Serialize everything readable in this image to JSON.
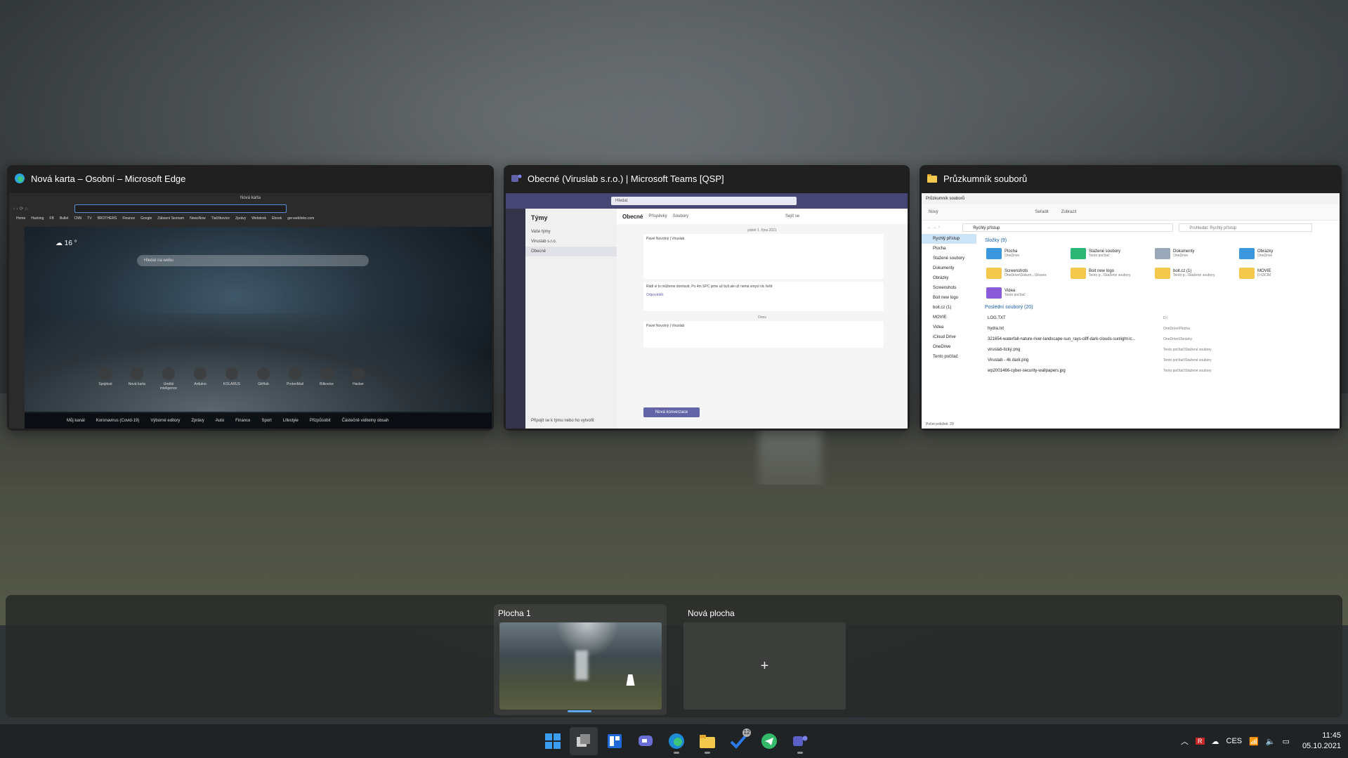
{
  "windows": {
    "edge": {
      "title": "Nová karta – Osobní – Microsoft Edge",
      "tab_title": "Nová karta",
      "favorites": [
        "Home",
        "Hacking",
        "FB",
        "Bullet",
        "CNN",
        "TV",
        "BROTHERS",
        "Finance",
        "Google",
        "Zábavní Seznam",
        "NewsNow",
        "Tlačítkovice",
        "Zprávy",
        "Webdesk",
        "Ebook",
        "gw-weblinks.com"
      ],
      "weather": "16 °",
      "search_placeholder": "Hledat na webu",
      "tiles": [
        "Spojitost",
        "Nová karta",
        "Umělá inteligence",
        "Arduino",
        "KOLARUS",
        "GitHub",
        "ProtonMail",
        "Bilkovice",
        "Hacker"
      ],
      "feed_tabs": [
        "Můj kanál",
        "Koronavirus (Covid-19)",
        "Výborné editory",
        "Zprávy",
        "Auto",
        "Finance",
        "Sport",
        "Lifestyle"
      ],
      "personalize": "Přizpůsobit",
      "visible_content": "Částečně viditelný obsah"
    },
    "teams": {
      "title": "Obecné (Viruslab s.r.o.) | Microsoft Teams [QSP]",
      "search": "Hledat",
      "list_header": "Týmy",
      "list_section": "Vaše týmy",
      "team_name": "Viruslab s.r.o.",
      "channel_item": "Obecné",
      "channel": "Obecné",
      "tabs": [
        "Příspěvky",
        "Soubory"
      ],
      "meet": "Sejít se",
      "date_divider": "pátek 1. října 2021",
      "today_divider": "Dnes",
      "msg1_author": "Pavel Novotný | Viruslab",
      "msg2_text": "Rádi si to můžeme domluvit. Po 4m SPC jsme už byli ale už nemá smysl nic řešit",
      "msg3_author": "Pavel Novotný | Viruslab",
      "reply": "Odpovědět",
      "new_conversation": "Nová konverzace",
      "join_or_create": "Připojit se k týmu nebo ho vytvořit"
    },
    "explorer": {
      "title": "Průzkumník souborů",
      "tab": "Průzkumník souborů",
      "commands": [
        "Nový",
        "Seřadit",
        "Zobrazit"
      ],
      "path": "Rychlý přístup",
      "search_placeholder": "Prohledat: Rychlý přístup",
      "nav": [
        "Rychlý přístup",
        "Plocha",
        "Stažené soubory",
        "Dokumenty",
        "Obrázky",
        "Screenshots",
        "Boit new logo",
        "boit.cz (1)",
        "MOVIE",
        "Videa",
        "iCloud Drive",
        "OneDrive",
        "Tento počítač"
      ],
      "folders_header": "Složky (9)",
      "folders": [
        {
          "name": "Plocha",
          "sub": "OneDrive"
        },
        {
          "name": "Stažené soubory",
          "sub": "Tento počítač"
        },
        {
          "name": "Dokumenty",
          "sub": "OneDrive"
        },
        {
          "name": "Obrázky",
          "sub": "OneDrive"
        },
        {
          "name": "Screenshots",
          "sub": "OneDrive\\Dokum...\\Sharex"
        },
        {
          "name": "Boit new logo",
          "sub": "Tento p...\\Stažené soubory"
        },
        {
          "name": "boit.cz (1)",
          "sub": "Tento p...\\Stažené soubory"
        },
        {
          "name": "MOVIE",
          "sub": "D:\\DCIM"
        },
        {
          "name": "Videa",
          "sub": "Tento počítač"
        }
      ],
      "recent_header": "Poslední soubory (20)",
      "recent": [
        {
          "name": "LOG.TXT",
          "loc": "D:\\"
        },
        {
          "name": "hydra.txt",
          "loc": "OneDrive\\Plocha"
        },
        {
          "name": "321654-waterfall-nature-river-landscape-sun_rays-cliff-dark-clouds-sunlight-lc...",
          "loc": "OneDrive\\Obrázky"
        },
        {
          "name": "viruslab-tický.png",
          "loc": "Tento počítač\\Stažené soubory"
        },
        {
          "name": "Viruslab - 4k dark.png",
          "loc": "Tento počítač\\Stažené soubory"
        },
        {
          "name": "wp2001466-cyber-security-wallpapers.jpg",
          "loc": "Tento počítač\\Stažené soubory"
        }
      ],
      "status": "Počet položek: 29"
    }
  },
  "desktops": {
    "desk1_label": "Plocha 1",
    "desk2_label": "Nová plocha",
    "add_symbol": "+"
  },
  "taskbar": {
    "apps": [
      "start-icon",
      "task-view-icon",
      "widgets-icon",
      "chat-icon",
      "edge-icon",
      "file-explorer-icon",
      "todo-icon",
      "telegram-icon",
      "teams-icon"
    ],
    "todo_badge": "12",
    "language": "CES",
    "time": "11:45",
    "date": "05.10.2021"
  },
  "colors": {
    "accent": "#5aa8f0",
    "teams_purple": "#6264a7"
  }
}
